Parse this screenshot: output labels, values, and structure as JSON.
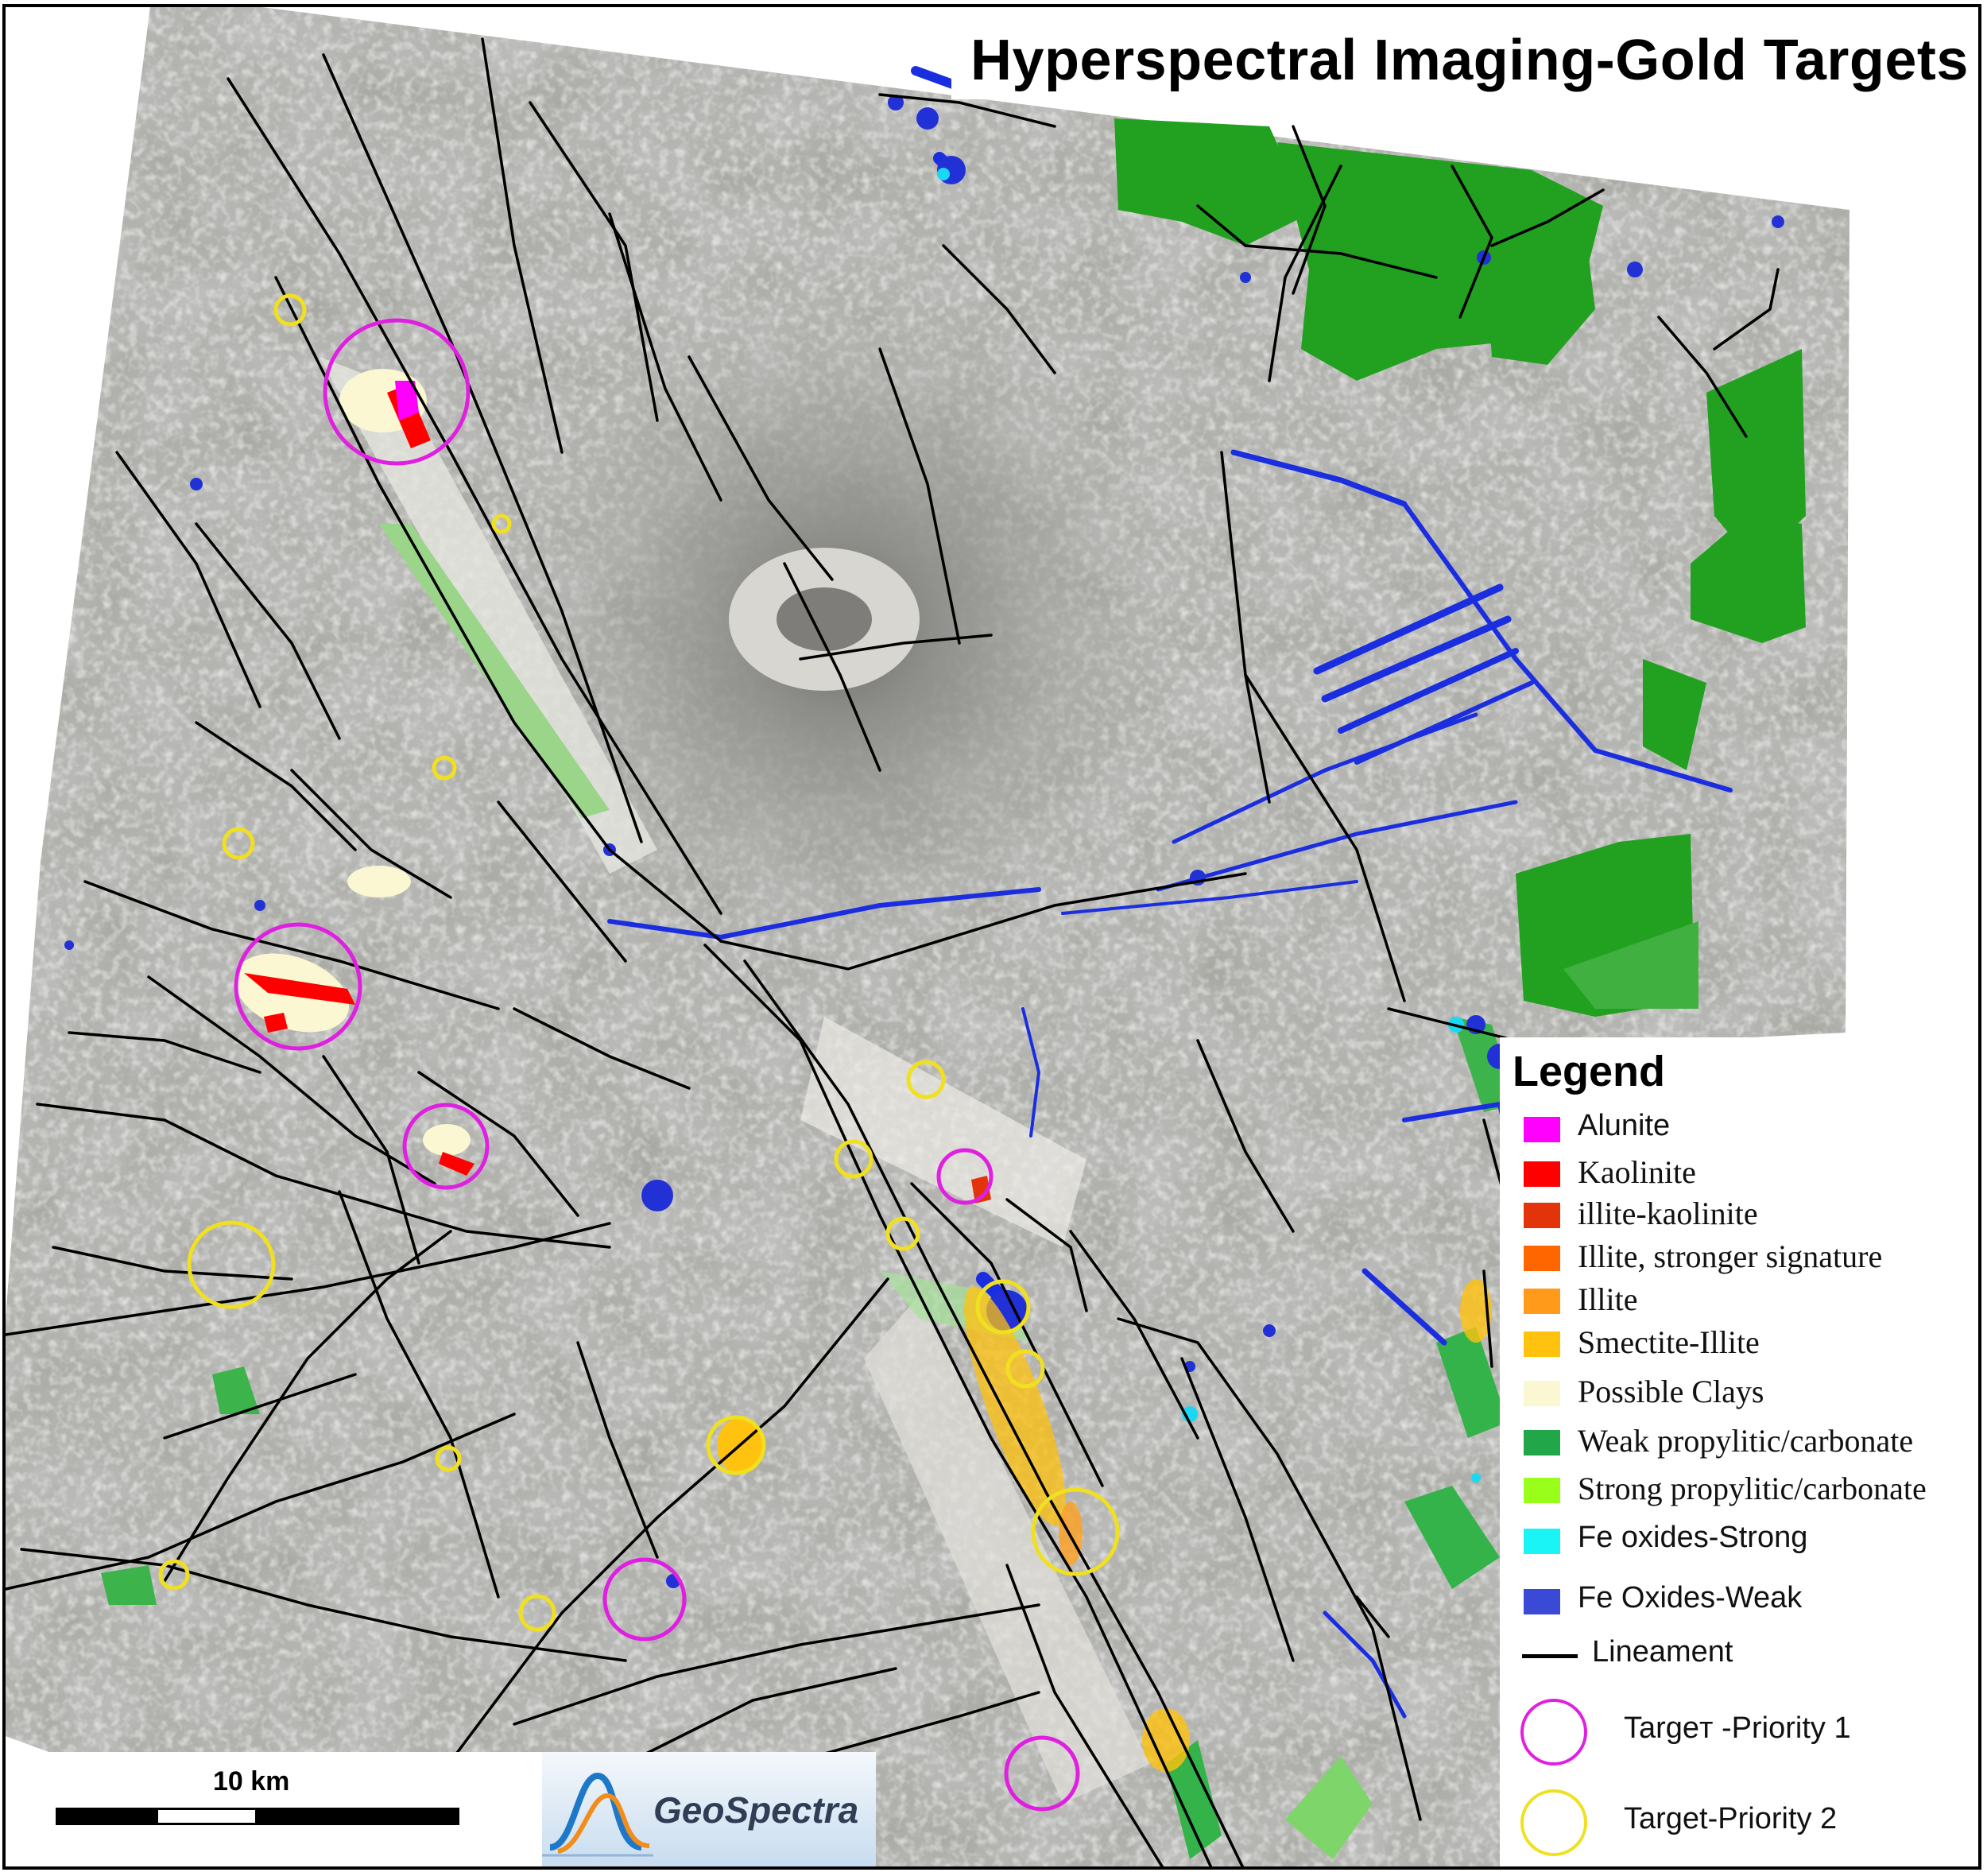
{
  "title": "Hyperspectral Imaging-Gold Targets",
  "legend": {
    "title": "Legend",
    "items": [
      {
        "label": "Alunite",
        "color": "#ff00ff",
        "kind": "swatch",
        "font": "sans"
      },
      {
        "label": "Kaolinite",
        "color": "#ff0000",
        "kind": "swatch",
        "font": "serif"
      },
      {
        "label": "illite-kaolinite",
        "color": "#e2330a",
        "kind": "swatch",
        "font": "serif"
      },
      {
        "label": "Illite, stronger  signature",
        "color": "#ff6600",
        "kind": "swatch",
        "font": "serif"
      },
      {
        "label": "Illite",
        "color": "#ff9a1a",
        "kind": "swatch",
        "font": "serif"
      },
      {
        "label": "Smectite-Illite",
        "color": "#ffc20e",
        "kind": "swatch",
        "font": "serif"
      },
      {
        "label": "Possible Clays",
        "color": "#fbf7d2",
        "kind": "swatch",
        "font": "serif"
      },
      {
        "label": "Weak  propylitic/carbonate",
        "color": "#22a64a",
        "kind": "swatch",
        "font": "serif"
      },
      {
        "label": "Strong  propylitic/carbonate",
        "color": "#99ff1a",
        "kind": "swatch",
        "font": "serif"
      },
      {
        "label": "Fe oxides-Strong",
        "color": "#1af4f4",
        "kind": "swatch",
        "font": "sans"
      },
      {
        "label": "Fe Oxides-Weak",
        "color": "#3a4ad6",
        "kind": "swatch",
        "font": "sans"
      },
      {
        "label": "Lineament",
        "color": "#000000",
        "kind": "line",
        "font": "sans"
      },
      {
        "label": "Targeт -Priority 1",
        "color": "#e020e0",
        "kind": "ring",
        "font": "sans"
      },
      {
        "label": "Target-Priority 2",
        "color": "#f0e020",
        "kind": "ring",
        "font": "sans"
      }
    ]
  },
  "scale": {
    "label": "10 km"
  },
  "logo": {
    "name": "GeoSpectra",
    "icon": "spectral-wave-icon"
  },
  "targets": {
    "priority_1_color": "#e020e0",
    "priority_2_color": "#f0e020"
  }
}
